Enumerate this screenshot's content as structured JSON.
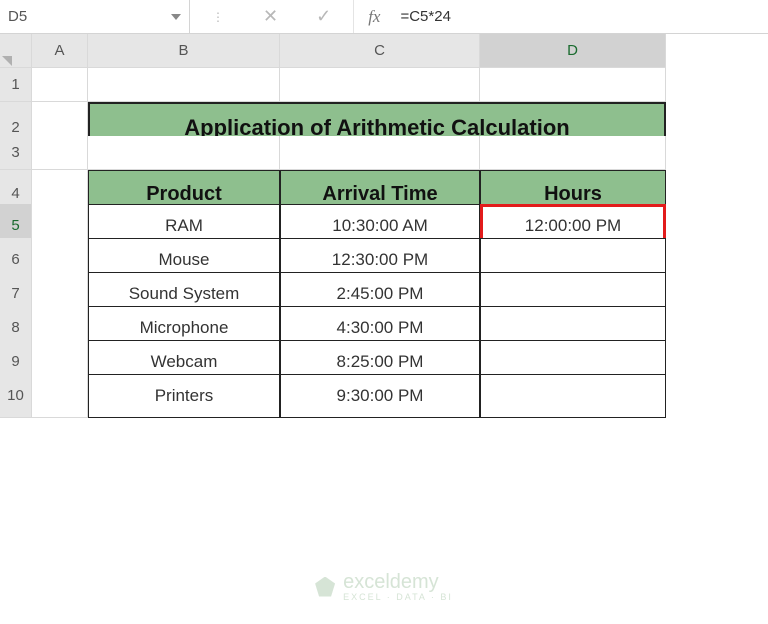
{
  "nameBox": {
    "value": "D5"
  },
  "formulaBar": {
    "fx": "fx",
    "formula": "=C5*24"
  },
  "columns": [
    "A",
    "B",
    "C",
    "D"
  ],
  "rows": [
    "1",
    "2",
    "3",
    "4",
    "5",
    "6",
    "7",
    "8",
    "9",
    "10"
  ],
  "title": "Application of Arithmetic Calculation",
  "headers": {
    "product": "Product",
    "arrival": "Arrival Time",
    "hours": "Hours"
  },
  "data": [
    {
      "product": "RAM",
      "arrival": "10:30:00 AM",
      "hours": "12:00:00 PM"
    },
    {
      "product": "Mouse",
      "arrival": "12:30:00 PM",
      "hours": ""
    },
    {
      "product": "Sound System",
      "arrival": "2:45:00 PM",
      "hours": ""
    },
    {
      "product": "Microphone",
      "arrival": "4:30:00 PM",
      "hours": ""
    },
    {
      "product": "Webcam",
      "arrival": "8:25:00 PM",
      "hours": ""
    },
    {
      "product": "Printers",
      "arrival": "9:30:00 PM",
      "hours": ""
    }
  ],
  "watermark": {
    "name": "exceldemy",
    "sub": "EXCEL · DATA · BI"
  },
  "activeCol": "D",
  "activeRow": "5",
  "chart_data": {
    "type": "table",
    "title": "Application of Arithmetic Calculation",
    "columns": [
      "Product",
      "Arrival Time",
      "Hours"
    ],
    "rows": [
      [
        "RAM",
        "10:30:00 AM",
        "12:00:00 PM"
      ],
      [
        "Mouse",
        "12:30:00 PM",
        ""
      ],
      [
        "Sound System",
        "2:45:00 PM",
        ""
      ],
      [
        "Microphone",
        "4:30:00 PM",
        ""
      ],
      [
        "Webcam",
        "8:25:00 PM",
        ""
      ],
      [
        "Printers",
        "9:30:00 PM",
        ""
      ]
    ]
  }
}
